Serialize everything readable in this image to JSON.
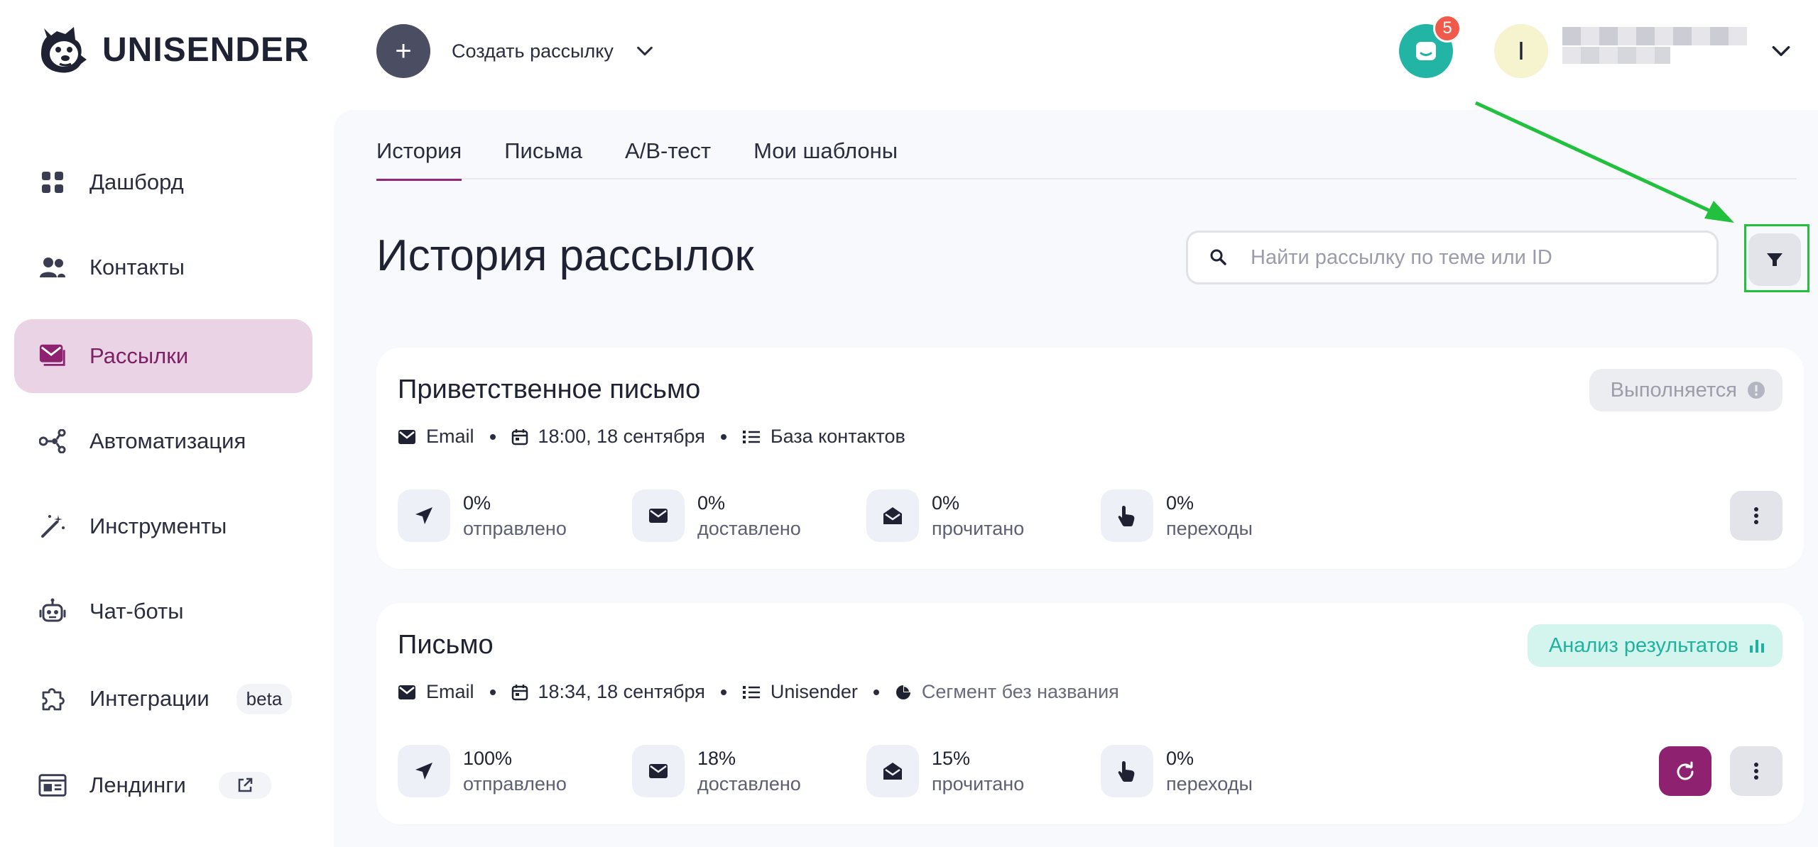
{
  "app": {
    "name": "UNISENDER"
  },
  "header": {
    "create_label": "Создать рассылку",
    "chat_badge": "5",
    "avatar_letter": "I"
  },
  "sidebar": {
    "items": [
      {
        "label": "Дашборд",
        "icon": "dashboard-icon"
      },
      {
        "label": "Контакты",
        "icon": "contacts-icon"
      },
      {
        "label": "Рассылки",
        "icon": "mail-icon",
        "active": true
      },
      {
        "label": "Автоматизация",
        "icon": "automation-icon"
      },
      {
        "label": "Инструменты",
        "icon": "magic-wand-icon"
      },
      {
        "label": "Чат-боты",
        "icon": "robot-icon"
      },
      {
        "label": "Интеграции",
        "icon": "puzzle-icon",
        "pill": "beta"
      },
      {
        "label": "Лендинги",
        "icon": "landing-icon",
        "pill_icon": "external-link-icon"
      }
    ]
  },
  "tabs": [
    {
      "label": "История",
      "active": true
    },
    {
      "label": "Письма"
    },
    {
      "label": "A/B-тест"
    },
    {
      "label": "Мои шаблоны"
    }
  ],
  "page_title": "История рассылок",
  "search": {
    "placeholder": "Найти рассылку по теме или ID",
    "value": ""
  },
  "campaigns": [
    {
      "title": "Приветственное письмо",
      "status": "Выполняется",
      "channel": "Email",
      "datetime": "18:00, 18 сентября",
      "list": "База контактов",
      "stats": [
        {
          "value": "0%",
          "label": "отправлено",
          "icon": "send-icon"
        },
        {
          "value": "0%",
          "label": "доставлено",
          "icon": "envelope-icon"
        },
        {
          "value": "0%",
          "label": "прочитано",
          "icon": "open-envelope-icon"
        },
        {
          "value": "0%",
          "label": "переходы",
          "icon": "pointer-hand-icon"
        }
      ]
    },
    {
      "title": "Письмо",
      "status": "Анализ результатов",
      "channel": "Email",
      "datetime": "18:34, 18 сентября",
      "list": "Unisender",
      "segment": "Сегмент без названия",
      "stats": [
        {
          "value": "100%",
          "label": "отправлено",
          "icon": "send-icon"
        },
        {
          "value": "18%",
          "label": "доставлено",
          "icon": "envelope-icon"
        },
        {
          "value": "15%",
          "label": "прочитано",
          "icon": "open-envelope-icon"
        },
        {
          "value": "0%",
          "label": "переходы",
          "icon": "pointer-hand-icon"
        }
      ]
    }
  ],
  "colors": {
    "brand": "#8e2270",
    "active_nav_bg": "#ead3e4",
    "chat": "#22b5a6",
    "badge": "#ef5a4a",
    "annotation": "#22c13d",
    "analysis_bg": "#d4f4ee",
    "analysis_text": "#1fb39e"
  }
}
